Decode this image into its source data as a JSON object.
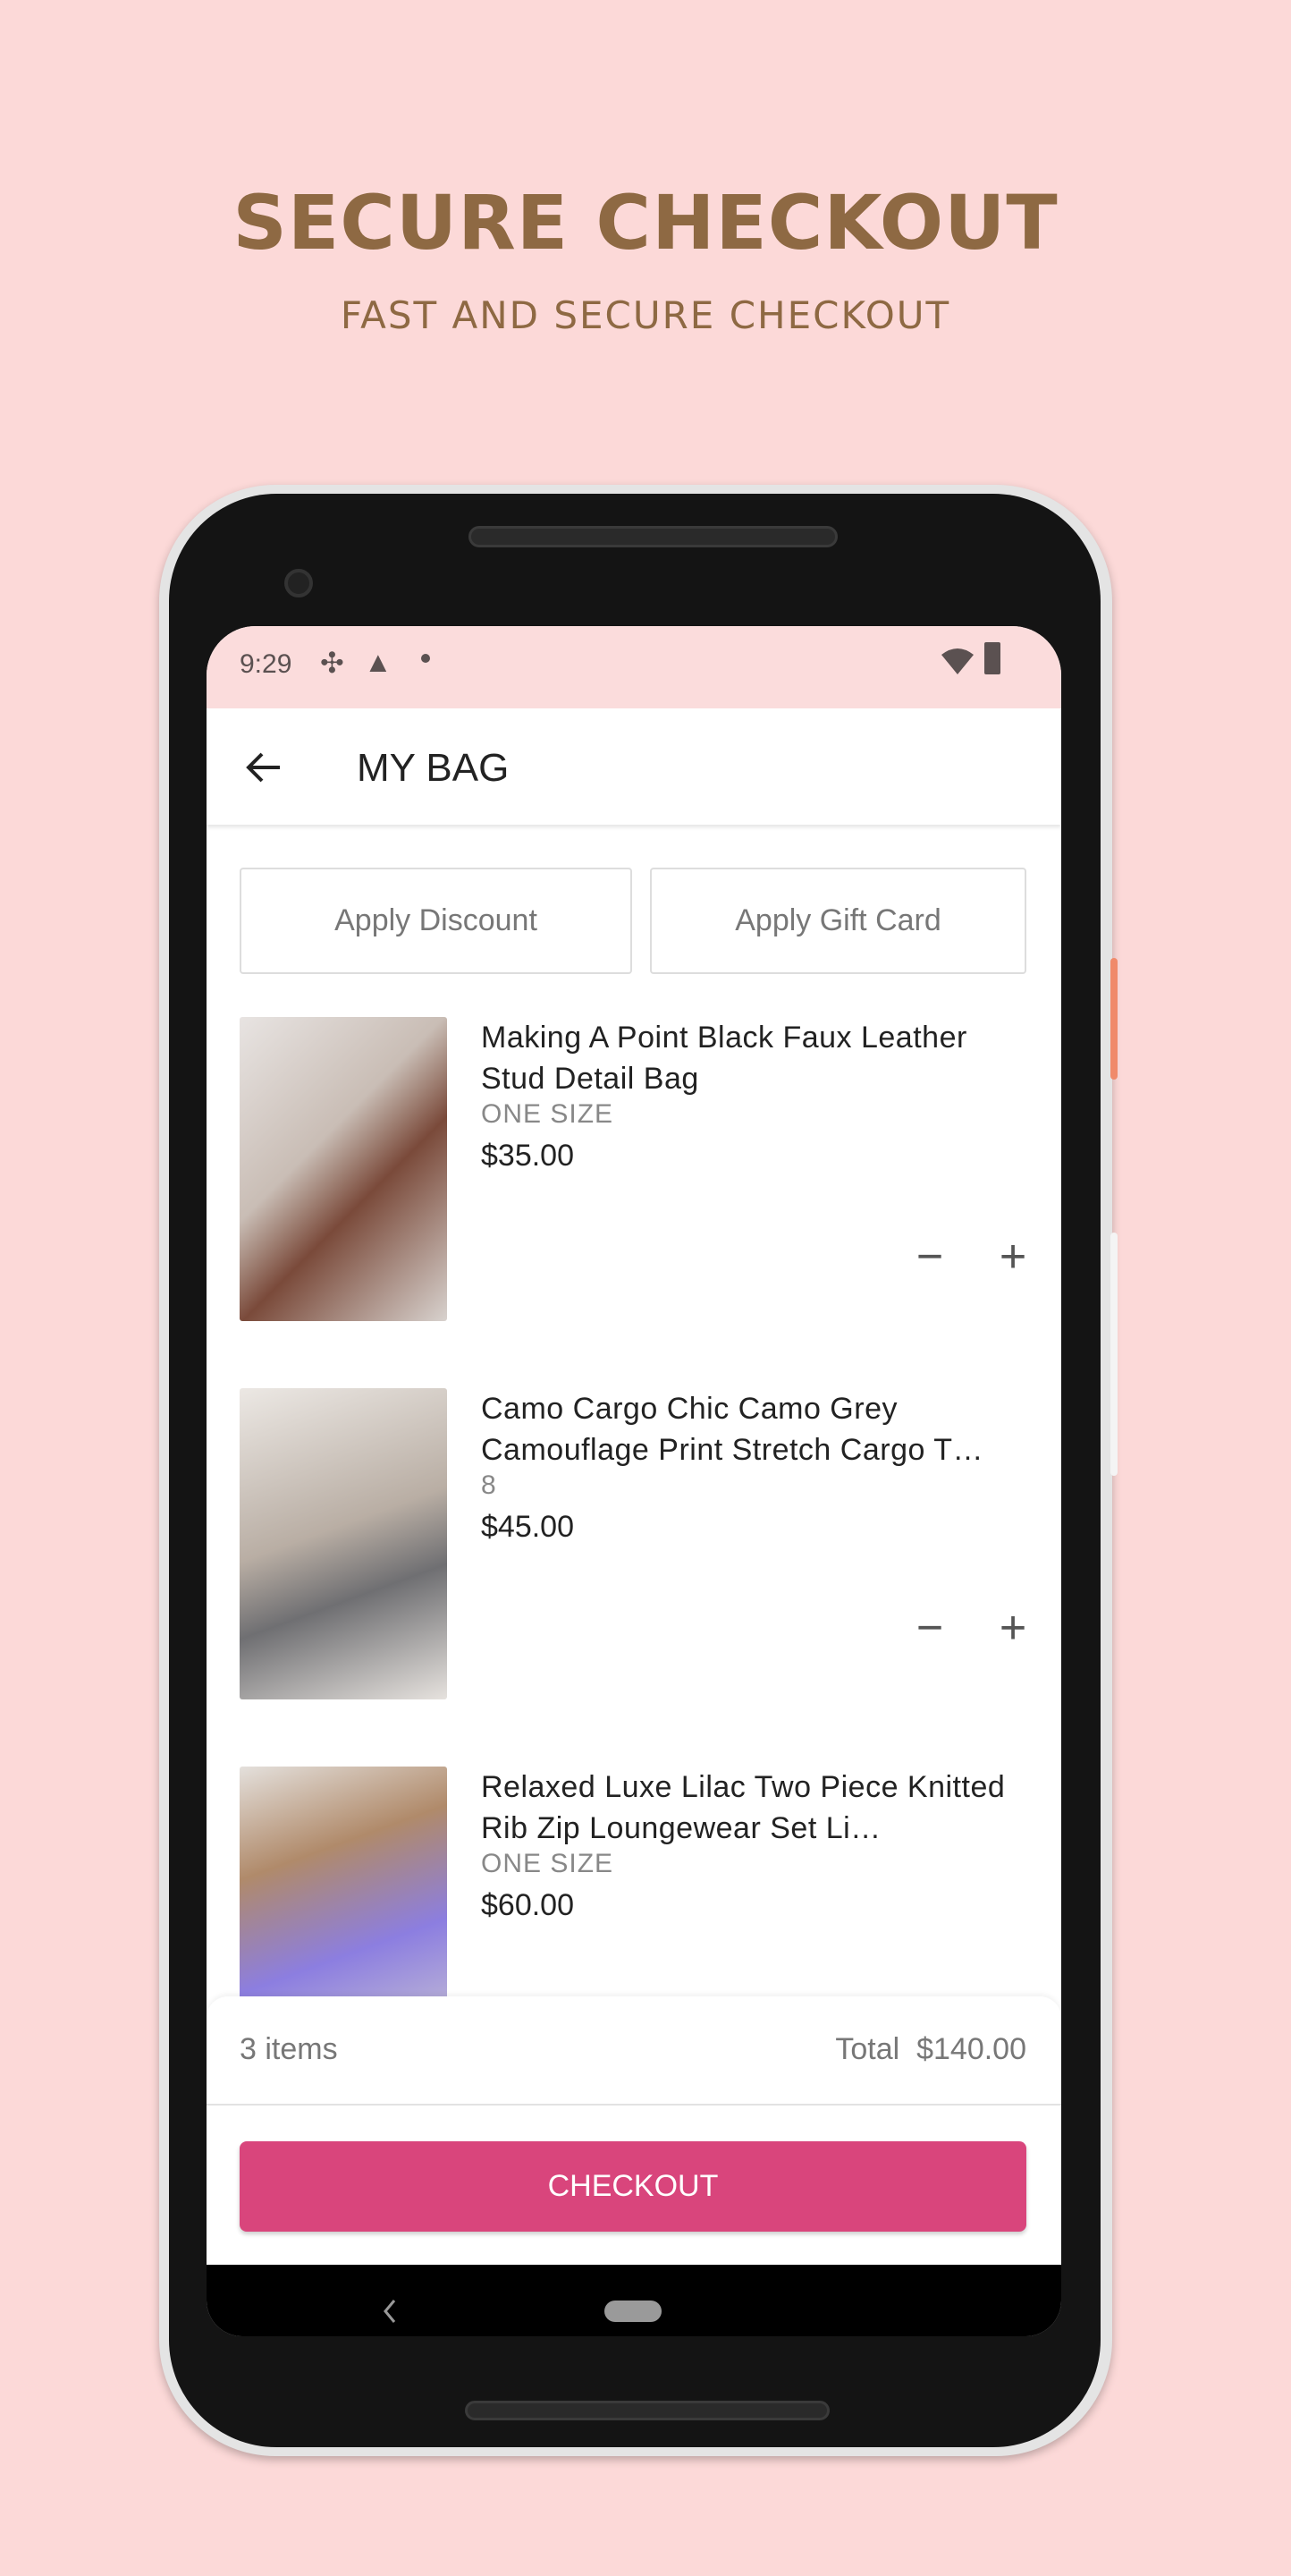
{
  "hero": {
    "title": "SECURE CHECKOUT",
    "subtitle": "FAST AND SECURE CHECKOUT"
  },
  "status_bar": {
    "time": "9:29",
    "icons_left": [
      "slack-icon",
      "warning-icon",
      "dot-icon"
    ],
    "icons_right": [
      "wifi-icon",
      "battery-charging-icon"
    ]
  },
  "app_bar": {
    "title": "MY BAG",
    "back_icon": "arrow-left-icon"
  },
  "actions": {
    "discount_label": "Apply Discount",
    "gift_card_label": "Apply Gift Card"
  },
  "items": [
    {
      "title": "Making A Point Black Faux Leather Stud Detail Bag",
      "size": "ONE SIZE",
      "price": "$35.00"
    },
    {
      "title": "Camo Cargo Chic Camo Grey Camouflage Print Stretch Cargo T…",
      "size": "8",
      "price": "$45.00"
    },
    {
      "title": "Relaxed Luxe Lilac Two Piece Knitted Rib Zip Loungewear Set Li…",
      "size": "ONE SIZE",
      "price": "$60.00"
    }
  ],
  "quantity": {
    "minus": "−",
    "plus": "+"
  },
  "summary": {
    "count": "3 items",
    "total_label": "Total",
    "total_value": "$140.00"
  },
  "checkout": {
    "label": "CHECKOUT"
  },
  "colors": {
    "background": "#fcd9d8",
    "hero_text": "#8e6943",
    "checkout": "#d9457c",
    "status_bar": "#fbdcdc"
  }
}
